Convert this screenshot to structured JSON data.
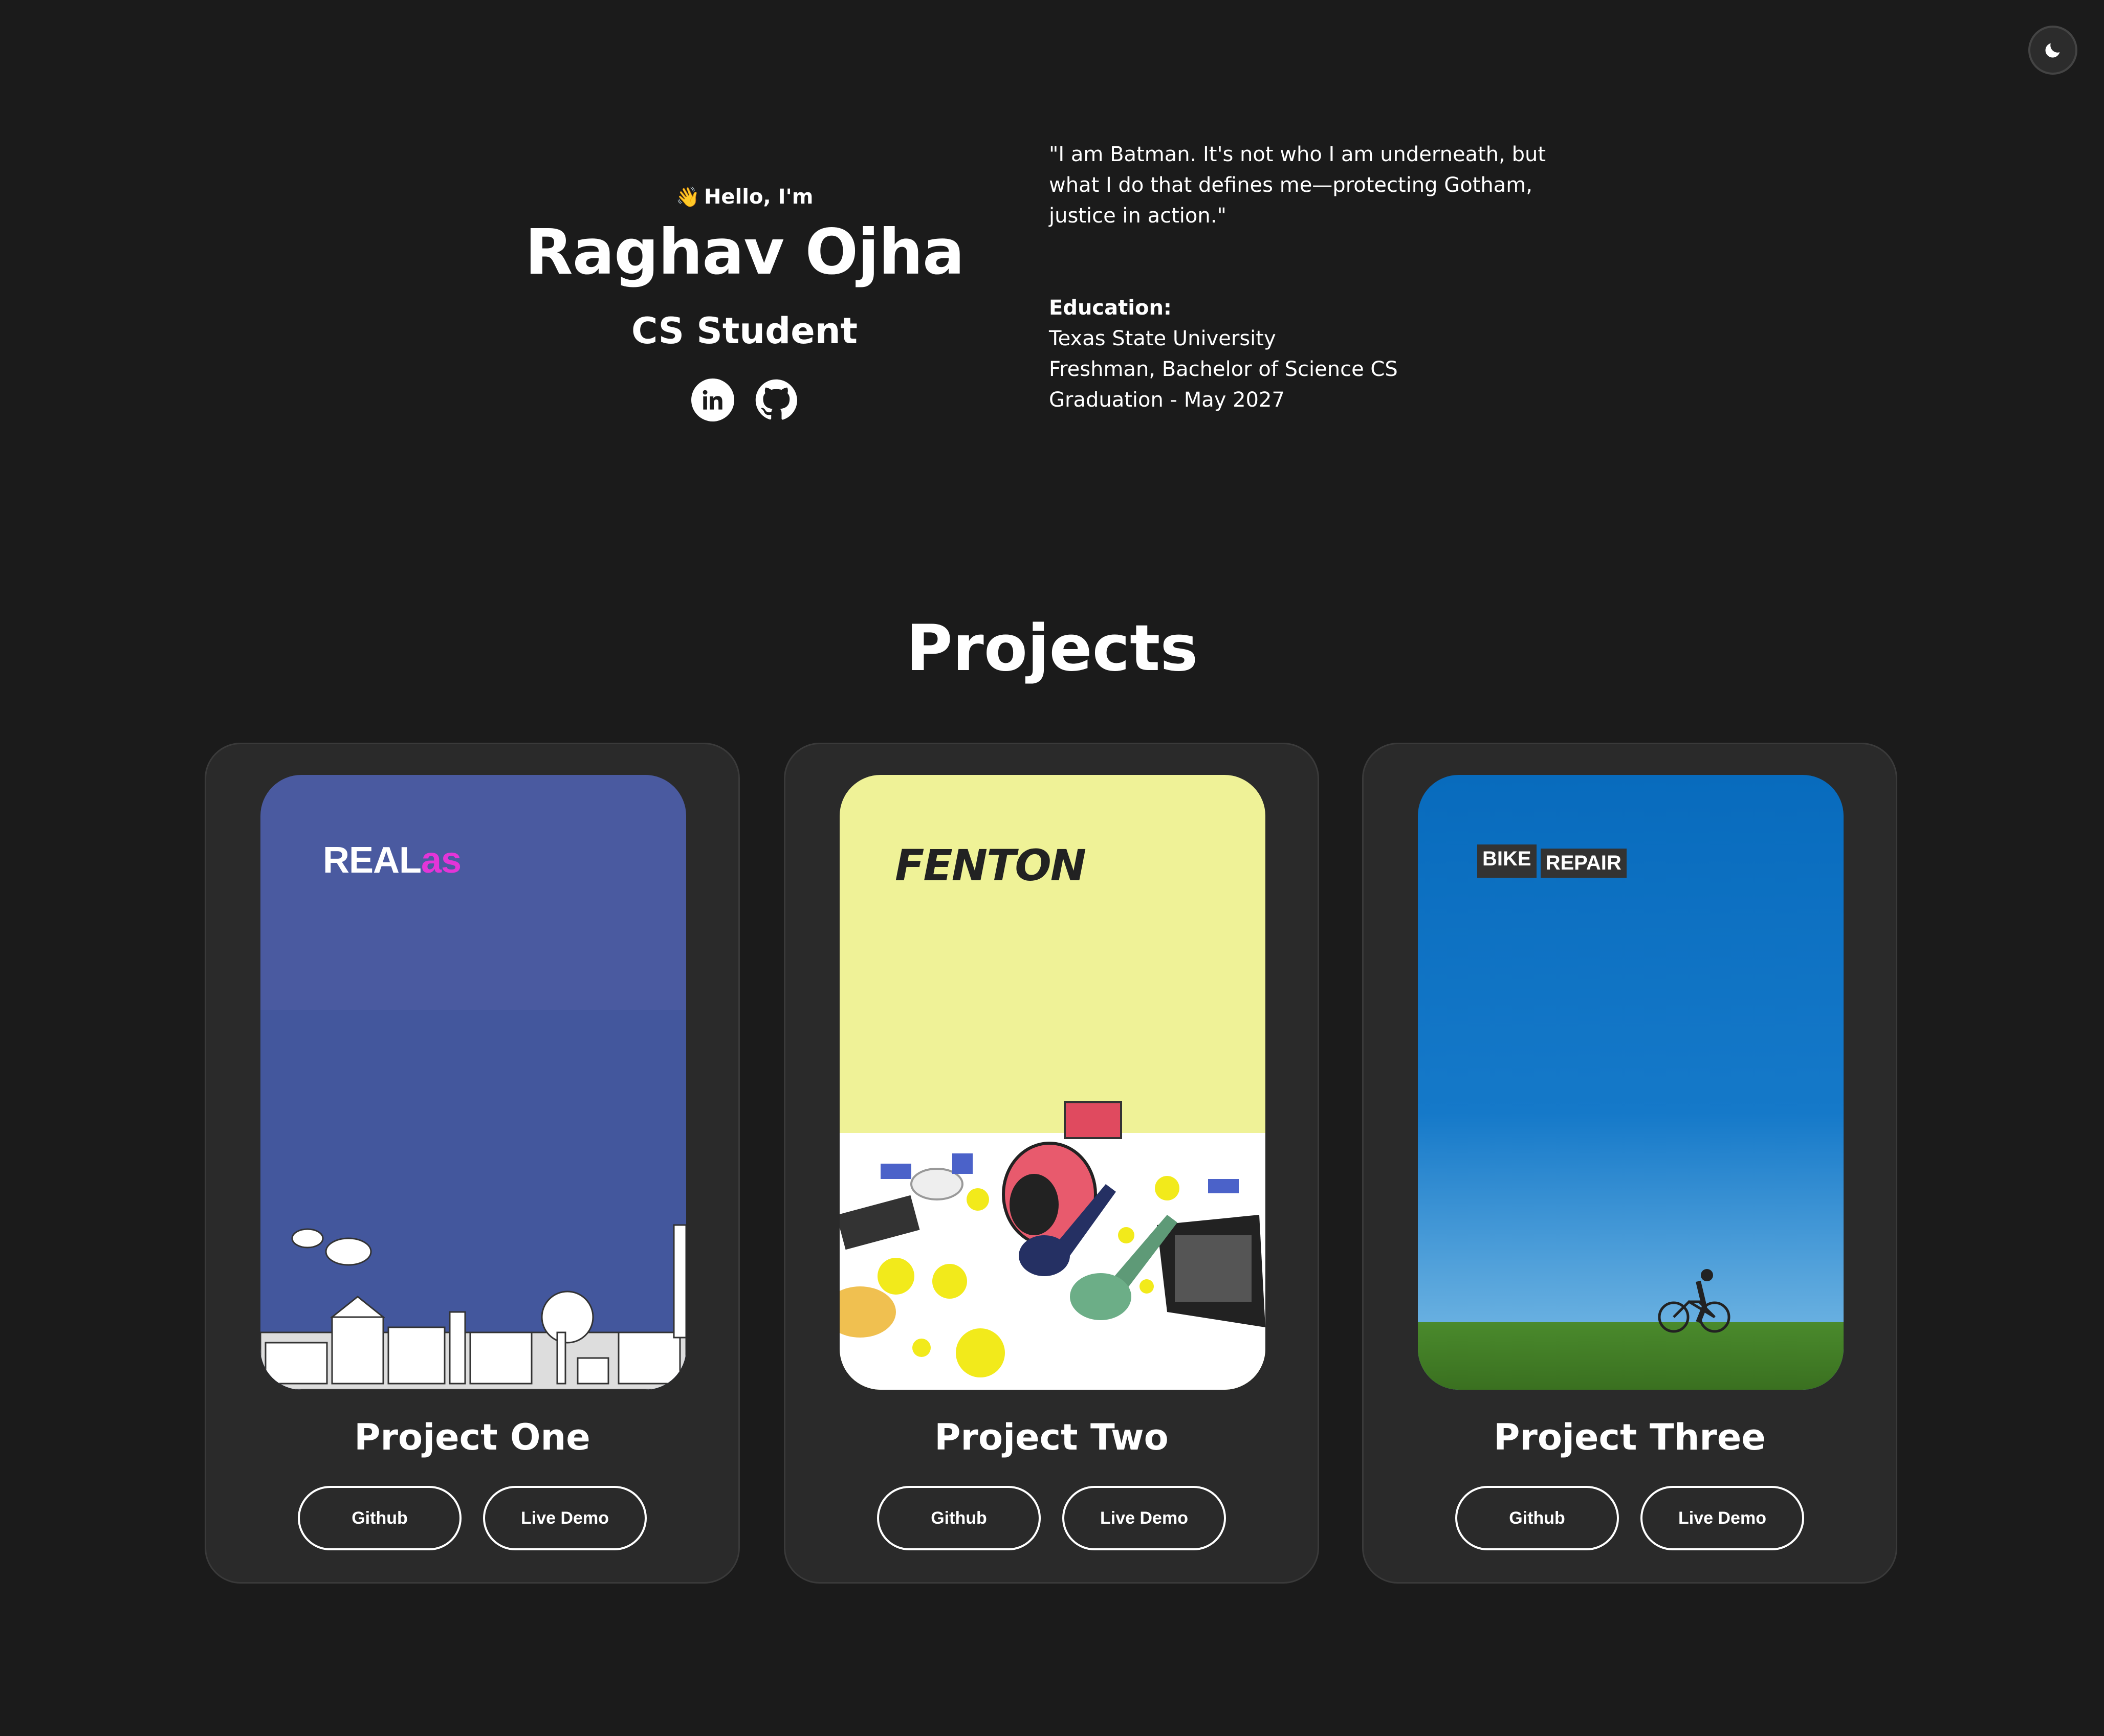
{
  "theme_toggle": {
    "icon": "moon-icon"
  },
  "hero": {
    "greeting": "Hello, I'm",
    "greeting_icon": "waving-hand-icon",
    "name": "Raghav Ojha",
    "role": "CS Student",
    "socials": [
      {
        "icon": "linkedin-icon"
      },
      {
        "icon": "github-icon"
      }
    ],
    "quote": "\"I am Batman. It's not who I am underneath, but what I do that defines me—protecting Gotham, justice in action.\"",
    "education": {
      "title": "Education:",
      "school": "Texas State University",
      "degree": "Freshman, Bachelor of Science CS",
      "graduation": "Graduation - May 2027"
    }
  },
  "projects": {
    "heading": "Projects",
    "items": [
      {
        "title": "Project One",
        "logo": "REAL",
        "logo_accent": "as",
        "github_label": "Github",
        "demo_label": "Live Demo"
      },
      {
        "title": "Project Two",
        "logo": "FENTON",
        "github_label": "Github",
        "demo_label": "Live Demo"
      },
      {
        "title": "Project Three",
        "logo_word1": "BIKE",
        "logo_word2": "REPAIR",
        "github_label": "Github",
        "demo_label": "Live Demo"
      }
    ]
  },
  "colors": {
    "background": "#1b1b1b",
    "card": "#2a2a2a",
    "realas_accent": "#e335d8",
    "realas_bg": "#4a5aa0",
    "fenton_bg": "#eff297",
    "bike_bg": "#086bbd"
  }
}
